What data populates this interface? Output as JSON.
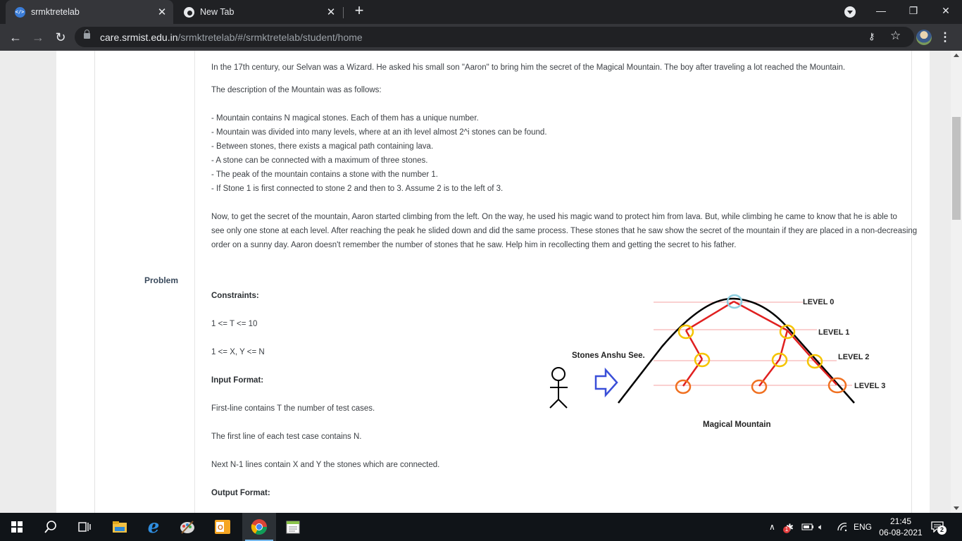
{
  "browser": {
    "tabs": [
      {
        "label": "srmktretelab",
        "favicon": "srm-logo-icon"
      },
      {
        "label": "New Tab",
        "favicon": "chrome-icon"
      }
    ],
    "new_tab_symbol": "+",
    "url_host": "care.srmist.edu.in",
    "url_path": "/srmktretelab/#/srmktretelab/student/home",
    "window_buttons": {
      "minimize": "—",
      "restore": "❐",
      "close": "✕"
    }
  },
  "page": {
    "section_label": "Problem",
    "intro": "In the 17th century, our Selvan was a Wizard. He asked his small son \"Aaron\" to bring him the secret of the Magical Mountain. The boy after traveling a lot reached the Mountain.",
    "desc_heading": "The description of the Mountain was as follows:",
    "bullets": [
      "- Mountain contains N magical stones. Each of them has a unique number.",
      "- Mountain was divided into many levels, where at an ith level almost 2^i stones can be found.",
      "- Between stones, there exists a magical path containing lava.",
      "- A stone can be connected with a maximum of three stones.",
      "- The peak of the mountain contains a stone with the number 1.",
      "- If Stone 1 is first connected to stone 2 and then to 3. Assume 2 is to the left of 3."
    ],
    "story_lines": [
      "Now, to get the secret of the mountain, Aaron started climbing from the left. On the way, he used his magic wand to protect him from lava. But, while climbing he came to know that he is able to",
      "see only one stone at each level. After reaching the peak he slided down and did the same process. These stones that he saw show the secret of the mountain if they are placed in a non-decreasing",
      "order on a sunny day. Aaron doesn't remember the number of stones that he saw. Help him in recollecting them and getting the secret to his father."
    ],
    "constraints_heading": "Constraints:",
    "constraint_1": "1 <= T <= 10",
    "constraint_2": "1 <= X, Y <= N",
    "input_heading": "Input Format:",
    "input_1": "First-line contains T the number of test cases.",
    "input_2": "The first line of each test case contains N.",
    "input_3": "Next N-1 lines contain X and Y the stones which are connected.",
    "output_heading": "Output Format:"
  },
  "diagram": {
    "observer_label": "Stones Anshu See.",
    "caption": "Magical Mountain",
    "levels": [
      "LEVEL 0",
      "LEVEL 1",
      "LEVEL 2",
      "LEVEL 3"
    ],
    "colors": {
      "mountain": "#000000",
      "lava_path": "#e02020",
      "level_line": "#f4a0a0",
      "peak_stone": "#8ecfe0",
      "stone_yellow": "#f5c400",
      "stone_orange": "#f07020",
      "arrow": "#3a4fd8"
    }
  },
  "taskbar": {
    "apps": [
      "windows-start-icon",
      "search-icon",
      "task-view-icon",
      "file-explorer-icon",
      "edge-icon",
      "paint-icon",
      "outlook-icon",
      "chrome-icon",
      "notepadpp-icon"
    ],
    "language": "ENG",
    "time": "21:45",
    "date": "06-08-2021",
    "notification_count": "2",
    "badge_count": "1"
  }
}
